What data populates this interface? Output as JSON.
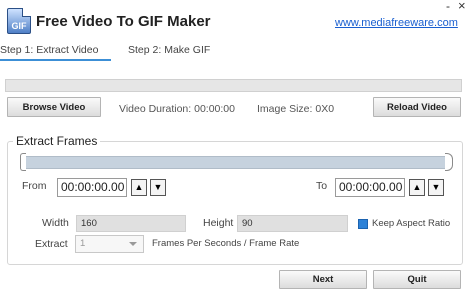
{
  "app": {
    "icon_text": "GIF",
    "title": "Free Video To GIF Maker",
    "website": "www.mediafreeware.com",
    "minimize": "-",
    "close": "×"
  },
  "tabs": [
    {
      "label": "Step 1: Extract Video",
      "active": true
    },
    {
      "label": "Step 2: Make GIF",
      "active": false
    }
  ],
  "toolbar": {
    "browse_label": "Browse Video",
    "duration_text": "Video Duration: 00:00:00",
    "image_size_text": "Image Size: 0X0",
    "reload_label": "Reload Video"
  },
  "extract": {
    "group_title": "Extract Frames",
    "from_label": "From",
    "from_value": "00:00:00.00",
    "to_label": "To",
    "to_value": "00:00:00.00",
    "spin_up": "▲",
    "spin_down": "▼",
    "width_label": "Width",
    "width_value": "160",
    "height_label": "Height",
    "height_value": "90",
    "keep_aspect_label": "Keep Aspect Ratio",
    "keep_aspect_checked": true,
    "extract_label": "Extract",
    "extract_value": "1",
    "fps_label": "Frames Per Seconds / Frame Rate"
  },
  "footer": {
    "next_label": "Next",
    "quit_label": "Quit"
  },
  "colors": {
    "accent": "#3c8fd6",
    "link": "#1a5fd0",
    "checkbox": "#2d82d8"
  }
}
